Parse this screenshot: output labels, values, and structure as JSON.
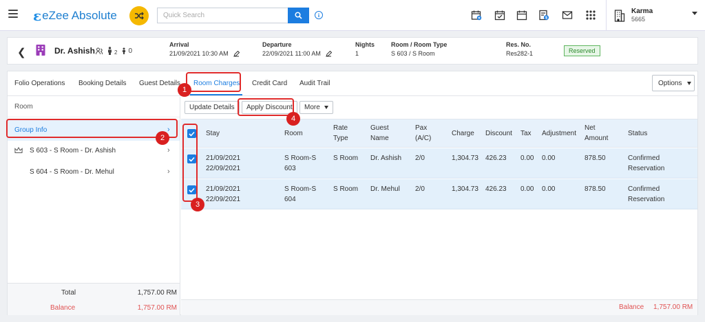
{
  "topbar": {
    "logo_text": "eZee Absolute",
    "search_placeholder": "Quick Search",
    "icons": [
      "calendar-plus-icon",
      "calendar-check-icon",
      "calendar-icon",
      "doc-dollar-icon",
      "mail-icon",
      "apps-grid-icon"
    ],
    "user": {
      "name": "Karma",
      "code": "5665"
    }
  },
  "reservation": {
    "guest_name": "Dr. Ashish",
    "adults": "2",
    "children": "0",
    "arrival_label": "Arrival",
    "arrival_value": "21/09/2021 10:30 AM",
    "departure_label": "Departure",
    "departure_value": "22/09/2021 11:00 AM",
    "nights_label": "Nights",
    "nights_value": "1",
    "room_label": "Room / Room Type",
    "room_value": "S 603 / S Room",
    "resno_label": "Res. No.",
    "resno_value": "Res282-1",
    "status": "Reserved"
  },
  "tabs": [
    {
      "label": "Folio Operations"
    },
    {
      "label": "Booking Details"
    },
    {
      "label": "Guest Details"
    },
    {
      "label": "Room Charges"
    },
    {
      "label": "Credit Card"
    },
    {
      "label": "Audit Trail"
    }
  ],
  "options_label": "Options",
  "left_panel": {
    "header": "Room",
    "items": [
      {
        "label": "Group Info"
      },
      {
        "label": "S 603 - S Room - Dr. Ashish"
      },
      {
        "label": "S 604 - S Room - Dr. Mehul"
      }
    ],
    "total_label": "Total",
    "total_value": "1,757.00 RM",
    "balance_label": "Balance",
    "balance_value": "1,757.00 RM"
  },
  "actions": {
    "update_details": "Update Details",
    "apply_discount": "Apply Discount",
    "more": "More"
  },
  "grid": {
    "headers": {
      "stay": "Stay",
      "room": "Room",
      "rate_type_1": "Rate",
      "rate_type_2": "Type",
      "guest_1": "Guest",
      "guest_2": "Name",
      "pax_1": "Pax",
      "pax_2": "(A/C)",
      "charge": "Charge",
      "discount": "Discount",
      "tax": "Tax",
      "adjustment": "Adjustment",
      "net_1": "Net",
      "net_2": "Amount",
      "status": "Status"
    },
    "rows": [
      {
        "stay_from": "21/09/2021",
        "stay_to": "22/09/2021",
        "room_1": "S Room-S",
        "room_2": "603",
        "rate_type": "S Room",
        "guest": "Dr. Ashish",
        "pax": "2/0",
        "charge": "1,304.73",
        "discount": "426.23",
        "tax": "0.00",
        "adjustment": "0.00",
        "net": "878.50",
        "status_1": "Confirmed",
        "status_2": "Reservation"
      },
      {
        "stay_from": "21/09/2021",
        "stay_to": "22/09/2021",
        "room_1": "S Room-S",
        "room_2": "604",
        "rate_type": "S Room",
        "guest": "Dr. Mehul",
        "pax": "2/0",
        "charge": "1,304.73",
        "discount": "426.23",
        "tax": "0.00",
        "adjustment": "0.00",
        "net": "878.50",
        "status_1": "Confirmed",
        "status_2": "Reservation"
      }
    ],
    "balance_label": "Balance",
    "balance_value": "1,757.00 RM"
  },
  "annotations": [
    "1",
    "2",
    "3",
    "4"
  ],
  "colors": {
    "accent": "#1c7de0",
    "highlight": "#e02a2a",
    "reserved": "#2c8a2c",
    "balance": "#e05252",
    "shuffle": "#f5b800"
  }
}
